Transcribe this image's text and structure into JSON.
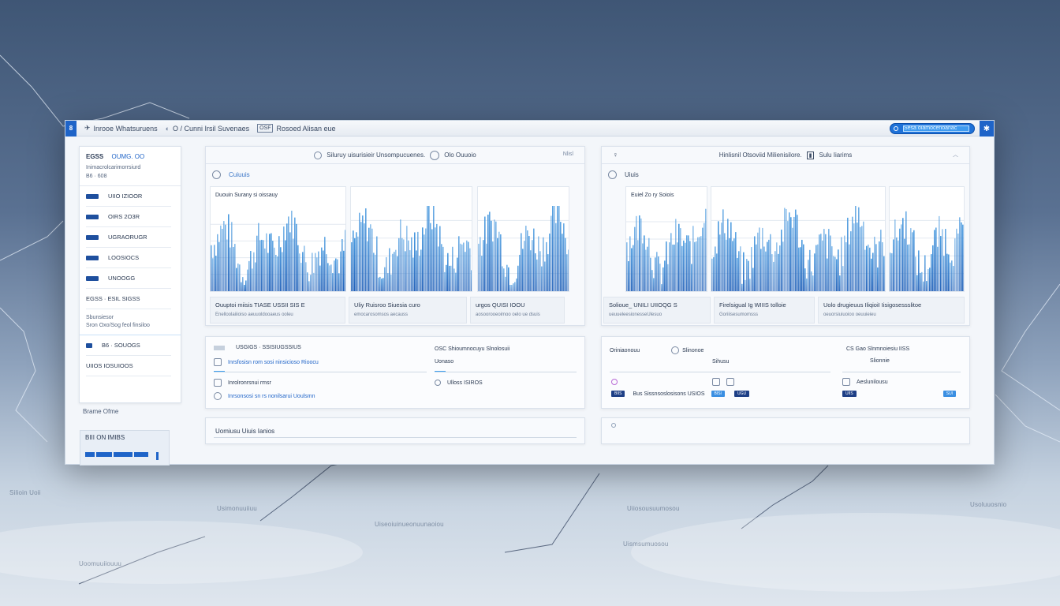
{
  "window": {
    "title_segments": [
      "Inrooe Whatsuruens",
      "O / Cunni Irsil Suvenaes",
      "Rosoed Alisan eue"
    ],
    "title_box": "OSF",
    "search_value": "Sesa olamocenoanac",
    "logo": "8",
    "close": "✱"
  },
  "sidebar": {
    "header_a": "EGSS",
    "header_b": "OUMG. OO",
    "sub_lines": [
      "Inimacrolcarimorrsiurd",
      "B6 · 608"
    ],
    "items": [
      {
        "label": "UIIO IZIOOR"
      },
      {
        "label": "OIRS 2O3R"
      },
      {
        "label": "UGRAORUGR"
      },
      {
        "label": "LOOSIOCS"
      },
      {
        "label": "UNOOGG"
      },
      {
        "label": "EGSS · ESIL SIGSS"
      }
    ],
    "note_lines": [
      "Sbunsiesor",
      "Sron Oxo/Sog feol finsiloo"
    ],
    "extra_items": [
      {
        "label": "B6 · SOUOGS"
      },
      {
        "label": "UIIOS IOSUIOOS"
      }
    ],
    "bottom_label": "Brame Ofme",
    "mini_title": "BIII ON IMIBS"
  },
  "panel_left": {
    "head_text": "Siluruy uisurisieir Unsompucuenes.",
    "head_aux": "Olo Ouuoio",
    "head_right": "Nlisl",
    "sub_label": "Cuiuuis",
    "chart_title": "Duouin Surany si oissauy",
    "legends": [
      {
        "l1": "Ouuptoi miisis  TIASE USSII SIS E",
        "l2": "Enelloolaiiioiso aeuuoldooaeus  ooleu"
      },
      {
        "l1": "Uliy  Ruisroo  Siuesia curo",
        "l2": "emocarosomsos aecauss"
      },
      {
        "l1": "urgos  QUISI IOOU",
        "l2": "aosoorooeoimoo oelo ue dsuis"
      }
    ]
  },
  "panel_right": {
    "head_text": "Hinlisnil Otsoviid Milienisilore.",
    "head_aux": "Sulu  Iiarims",
    "head_left": "♀",
    "sub_label": "Uiuis",
    "chart_title": "Euiel Zo ry Soiois",
    "legends": [
      {
        "l1": "Solioue_ UNILI UIIOQG S",
        "l2": "ueuueleesionesseUlesuo"
      },
      {
        "l1": "Firelsigual Ig  WIIIS tolloie",
        "l2": "Goriiisesumomsss"
      },
      {
        "l1": "Uolo  drugieuus  IliqioiI  Iisigosessslitoe",
        "l2": "oeuorsiuiuoioo oeuuieieu"
      }
    ]
  },
  "lower_left": {
    "top_left": "USGIGS  ·  SSISIUGSSIUS",
    "rows": [
      {
        "text": "Inrsfosisn rom sosi ninsicioso Rioocu"
      },
      {
        "text": "Inrolronrsnui rmsr"
      },
      {
        "text": "Inrsonsosi sn rs nonilsarui Uoulsmn"
      }
    ],
    "right_title": "OSC  Shioumnocuyu  Slnolosuii",
    "right_sub": "Uonaso",
    "right_row": "Ulloss  ISIROS"
  },
  "lower_right": {
    "top_left": "Oriniaonouu",
    "top_mid": "Slinonoe",
    "mid_label": "Sihusu",
    "row_text": "Bus  Sissnsoslosisons  USIOS",
    "right_title": "CS Gao  Slnmnoiesiu  IISS",
    "right_sub": "Slionnie",
    "right_mid": "Aeslunilousu",
    "tags": [
      "BIIS",
      "BISI",
      "UGU",
      "UIIS",
      "SUI"
    ]
  },
  "bottom_left_label": "Uomiusu Uiuis Ianios",
  "colors": {
    "accent": "#1f64c8",
    "chart_fill": "#4a9be0",
    "chart_fill_dark": "#1f5fb8",
    "window_bg": "#f3f6fa"
  }
}
